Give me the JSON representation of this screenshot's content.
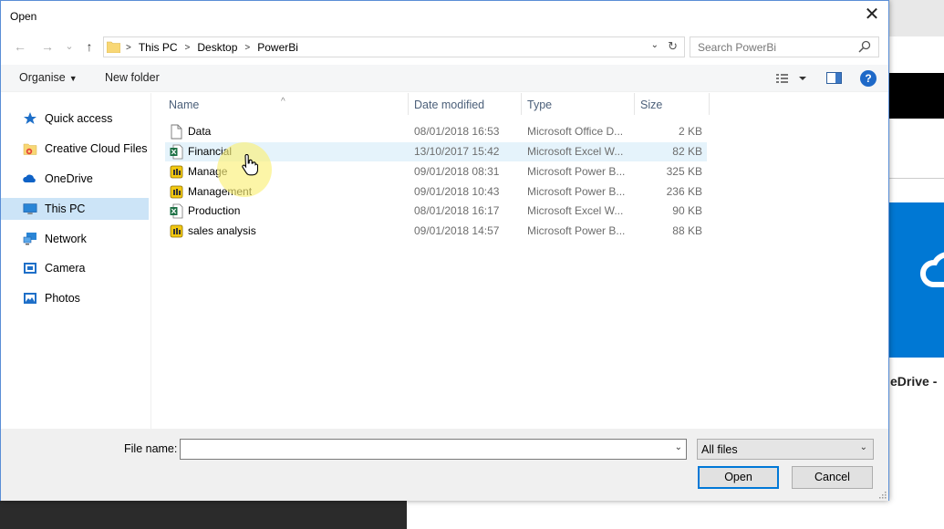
{
  "dialog": {
    "title": "Open",
    "close_glyph": "✕"
  },
  "address": {
    "back_glyph": "←",
    "forward_glyph": "→",
    "recent_glyph": "⌄",
    "up_glyph": "↑",
    "crumbs": [
      "This PC",
      "Desktop",
      "PowerBi"
    ],
    "crumb_sep": ">",
    "dropdown_glyph": "⌄",
    "refresh_glyph": "↻"
  },
  "search": {
    "placeholder": "Search PowerBi"
  },
  "toolbar": {
    "organise_label": "Organise",
    "organise_caret": "▼",
    "new_folder_label": "New folder",
    "help_glyph": "?"
  },
  "nav": {
    "items": [
      {
        "label": "Quick access",
        "icon": "star-icon"
      },
      {
        "label": "Creative Cloud Files",
        "icon": "creative-cloud-folder-icon"
      },
      {
        "label": "OneDrive",
        "icon": "onedrive-cloud-icon"
      },
      {
        "label": "This PC",
        "icon": "monitor-icon",
        "selected": true
      },
      {
        "label": "Network",
        "icon": "network-icon"
      },
      {
        "label": "Camera",
        "icon": "camera-icon"
      },
      {
        "label": "Photos",
        "icon": "photos-icon"
      }
    ]
  },
  "columns": {
    "name": "Name",
    "date": "Date modified",
    "type": "Type",
    "size": "Size",
    "sort_caret": "^"
  },
  "files": [
    {
      "name": "Data",
      "date": "08/01/2018 16:53",
      "type": "Microsoft Office D...",
      "size": "2 KB",
      "icon": "document-icon"
    },
    {
      "name": "Financial",
      "date": "13/10/2017 15:42",
      "type": "Microsoft Excel W...",
      "size": "82 KB",
      "icon": "excel-file-icon",
      "hover": true
    },
    {
      "name": "Manage",
      "date": "09/01/2018 08:31",
      "type": "Microsoft Power B...",
      "size": "325 KB",
      "icon": "powerbi-file-icon"
    },
    {
      "name": "Management",
      "date": "09/01/2018 10:43",
      "type": "Microsoft Power B...",
      "size": "236 KB",
      "icon": "powerbi-file-icon"
    },
    {
      "name": "Production",
      "date": "08/01/2018 16:17",
      "type": "Microsoft Excel W...",
      "size": "90 KB",
      "icon": "excel-file-icon"
    },
    {
      "name": "sales analysis",
      "date": "09/01/2018 14:57",
      "type": "Microsoft Power B...",
      "size": "88 KB",
      "icon": "powerbi-file-icon"
    }
  ],
  "bottom": {
    "file_name_label": "File name:",
    "file_name_value": "",
    "filter_value": "All files",
    "dropdown_glyph": "⌄",
    "open_label": "Open",
    "cancel_label": "Cancel"
  },
  "background": {
    "label_fragment": "eDrive -"
  },
  "colors": {
    "accent": "#0078d7",
    "selected_nav": "#cce4f7",
    "hover_row": "#e5f3fb",
    "folder": "#f8d775",
    "excel": "#1e7145",
    "powerbi": "#f2c811"
  }
}
